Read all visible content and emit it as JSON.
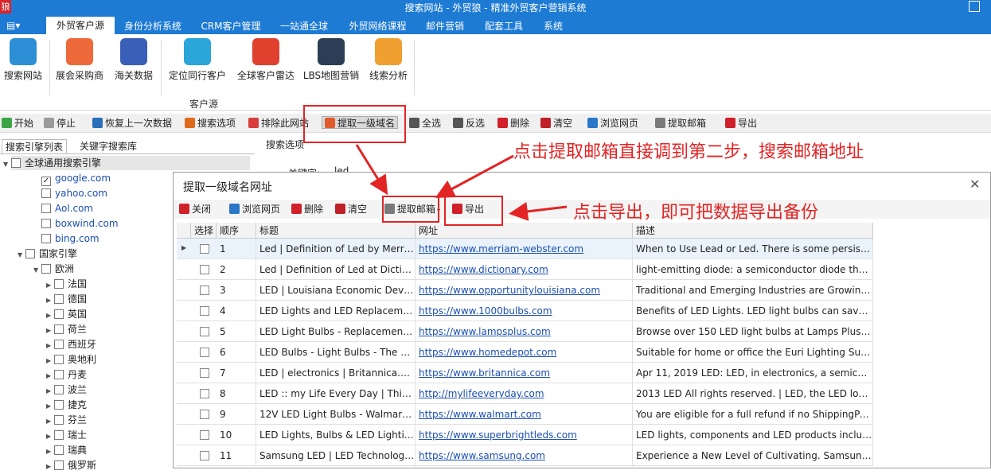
{
  "window": {
    "title": "搜索网站 - 外贸狼 - 精准外贸客户营销系统",
    "logo_char": "狼"
  },
  "ribbon_tabs": [
    "外贸客户源",
    "身份分析系统",
    "CRM客户管理",
    "一站通全球",
    "外贸网络课程",
    "邮件营销",
    "配套工具",
    "系统"
  ],
  "ribbon_buttons": [
    {
      "label": "搜索网站",
      "icon": "globe-search-icon",
      "color": "#2c8fd6"
    },
    {
      "label": "展会采购商",
      "icon": "search-magnifier-icon",
      "color": "#ef6a3a"
    },
    {
      "label": "海关数据",
      "icon": "binders-icon",
      "color": "#3a5fb8"
    },
    {
      "label": "定位同行客户",
      "icon": "pie-segments-icon",
      "color": "#2aa6d8"
    },
    {
      "label": "全球客户雷达",
      "icon": "radar-target-icon",
      "color": "#e0412f"
    },
    {
      "label": "LBS地图营销",
      "icon": "map-pin-icon",
      "color": "#2b3e55"
    },
    {
      "label": "线索分析",
      "icon": "email-notebook-icon",
      "color": "#f0a030"
    }
  ],
  "ribbon_group_label": "客户源",
  "toolbar": [
    "开始",
    "停止",
    "恢复上一次数据",
    "搜索选项",
    "排除此网站",
    "提取一级域名",
    "全选",
    "反选",
    "删除",
    "清空",
    "浏览网页",
    "提取邮箱",
    "导出"
  ],
  "left_tabs": [
    "搜索引擎列表",
    "关键字搜索库"
  ],
  "tree": {
    "root": "全球通用搜索引擎",
    "engines": [
      "google.com",
      "yahoo.com",
      "Aol.com",
      "boxwind.com",
      "bing.com"
    ],
    "national": "国家引擎",
    "europe": "欧洲",
    "countries": [
      "法国",
      "德国",
      "英国",
      "荷兰",
      "西班牙",
      "奥地利",
      "丹麦",
      "波兰",
      "捷克",
      "芬兰",
      "瑞士",
      "瑞典",
      "俄罗斯"
    ]
  },
  "search_options_label": "搜索选项",
  "keyword_label": "关键字:",
  "keyword_value": "led",
  "dialog": {
    "title": "提取一级域名网址",
    "toolbar": [
      "关闭",
      "浏览网页",
      "删除",
      "清空",
      "提取邮箱",
      "导出"
    ],
    "columns": [
      "选择",
      "顺序",
      "标题",
      "网址",
      "描述"
    ],
    "rows": [
      {
        "n": "1",
        "title": "Led | Definition of Led by Merria...",
        "url": "https://www.merriam-webster.com",
        "desc": "When to Use Lead or Led. There is some persisten..."
      },
      {
        "n": "2",
        "title": "Led | Definition of Led at Diction...",
        "url": "https://www.dictionary.com",
        "desc": "light-emitting diode: a semiconductor diode that e..."
      },
      {
        "n": "3",
        "title": "LED | Louisiana Economic Develo...",
        "url": "https://www.opportunitylouisiana.com",
        "desc": "Traditional and Emerging Industries are Growing in ..."
      },
      {
        "n": "4",
        "title": "LED Lights and LED Replacemen...",
        "url": "https://www.1000bulbs.com",
        "desc": "Benefits of LED Lights. LED light bulbs can save yo..."
      },
      {
        "n": "5",
        "title": "LED Light Bulbs - Replacement L...",
        "url": "https://www.lampsplus.com",
        "desc": "Browse over 150 LED light bulbs at Lamps Plus. Ma..."
      },
      {
        "n": "6",
        "title": "LED Bulbs - Light Bulbs - The Ho...",
        "url": "https://www.homedepot.com",
        "desc": "Suitable for home or office the Euri Lighting Suitabl..."
      },
      {
        "n": "7",
        "title": "LED | electronics | Britannica.com",
        "url": "https://www.britannica.com",
        "desc": "Apr 11, 2019 LED: LED, in electronics, a semicond..."
      },
      {
        "n": "8",
        "title": "LED :: my Life Every Day | This is ...",
        "url": "http://mylifeeveryday.com",
        "desc": " 2013 LED All rights reserved. | LED, the LED logo ..."
      },
      {
        "n": "9",
        "title": "12V LED Light Bulbs - Walmart.c...",
        "url": "https://www.walmart.com",
        "desc": "You are eligible for a full refund if no ShippingPass-..."
      },
      {
        "n": "10",
        "title": "LED Lights, Bulbs & LED Lighting...",
        "url": "https://www.superbrightleds.com",
        "desc": "LED lights, components and LED products including..."
      },
      {
        "n": "11",
        "title": "Samsung LED | LED Technology ...",
        "url": "https://www.samsung.com",
        "desc": "Experience a New Level of Cultivating. Samsung LE..."
      }
    ]
  },
  "annotations": {
    "email_hint": "点击提取邮箱直接调到第二步，搜索邮箱地址",
    "export_hint": "点击导出，即可把数据导出备份"
  }
}
